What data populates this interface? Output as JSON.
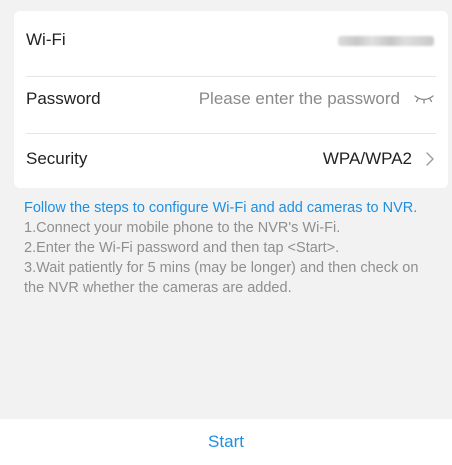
{
  "form": {
    "wifi_label": "Wi-Fi",
    "password_label": "Password",
    "password_placeholder": "Please enter the password",
    "password_value": "",
    "security_label": "Security",
    "security_value": "WPA/WPA2"
  },
  "instructions": {
    "title": "Follow the steps to configure Wi-Fi and add cameras to NVR.",
    "steps": [
      "1.Connect your mobile phone to the NVR's Wi-Fi.",
      "2.Enter the Wi-Fi password and then tap <Start>.",
      "3.Wait patiently for 5 mins (may be longer) and then check on the NVR whether the cameras are added."
    ]
  },
  "footer": {
    "start_label": "Start"
  },
  "icons": {
    "password_toggle": "eye-closed-icon",
    "security_chevron": "chevron-right-icon"
  },
  "colors": {
    "accent": "#1f8fe0",
    "hint_text": "#8f8f8f",
    "background": "#f2f2f2",
    "card": "#ffffff"
  }
}
